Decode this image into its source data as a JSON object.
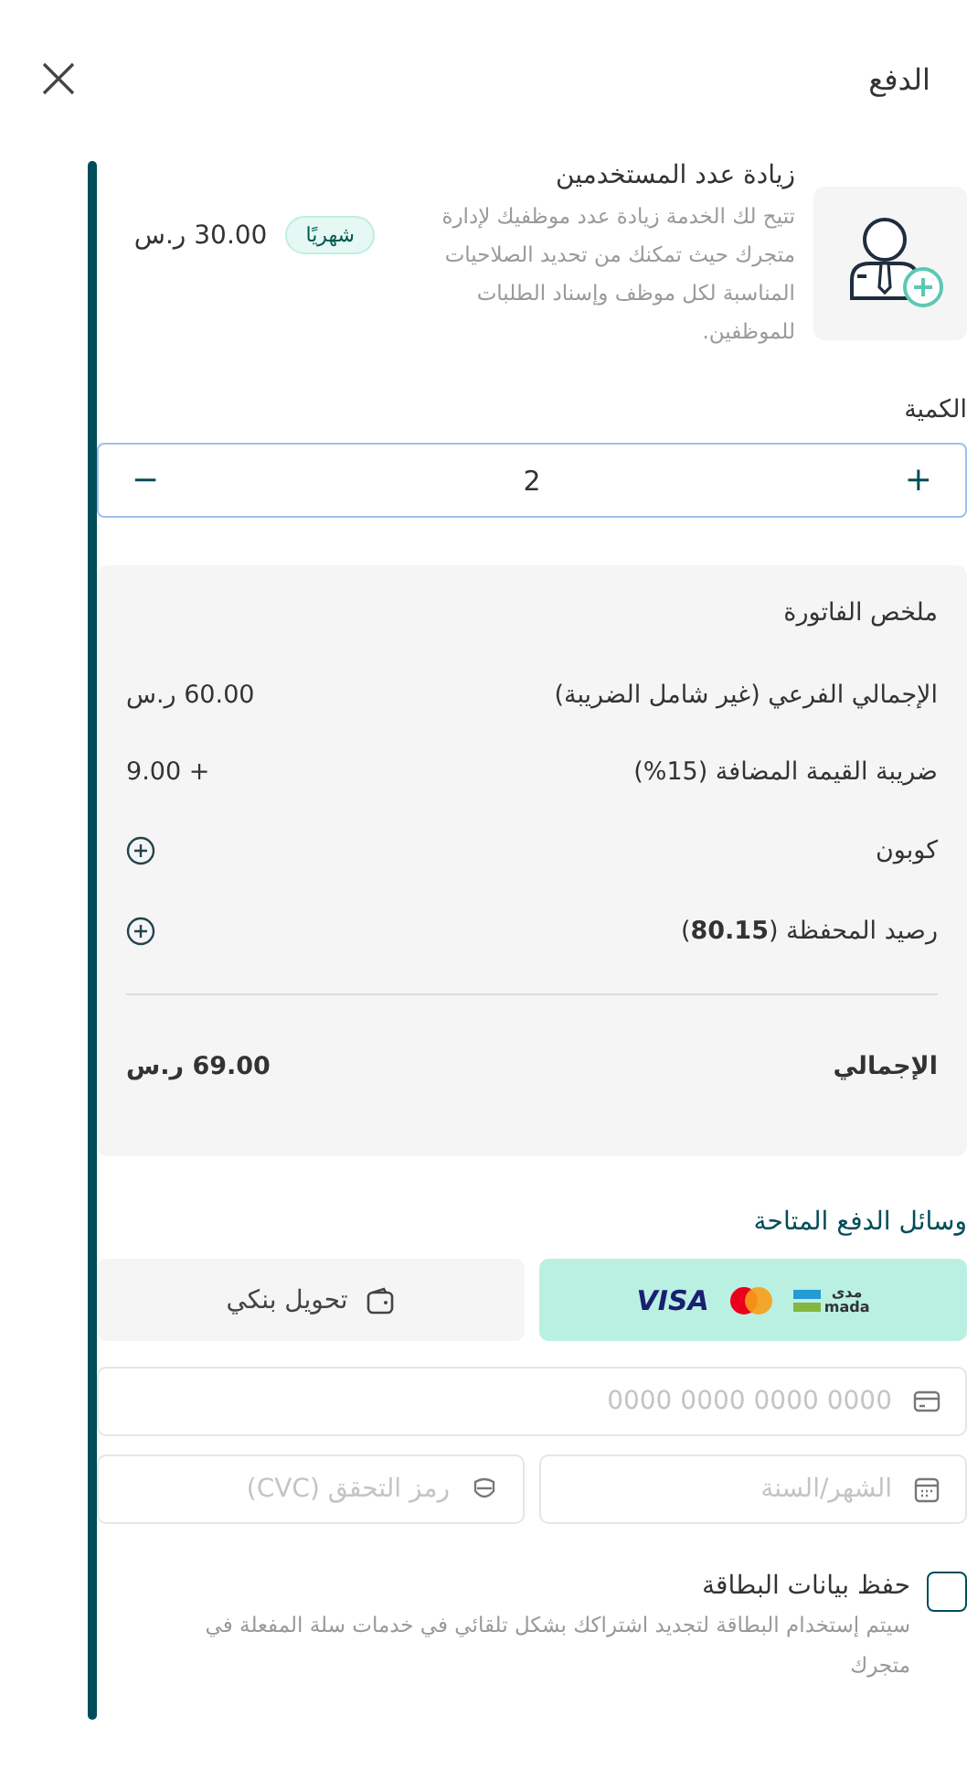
{
  "header": {
    "title": "الدفع"
  },
  "product": {
    "name": "زيادة عدد المستخدمين",
    "description": "تتيح لك الخدمة زيادة عدد موظفيك لإدارة متجرك حيث تمكنك من تحديد الصلاحيات المناسبة لكل موظف وإسناد الطلبات للموظفين.",
    "period": "شهريًا",
    "price": "30.00 ر.س"
  },
  "quantity": {
    "label": "الكمية",
    "value": "2",
    "plus": "+",
    "minus": "−"
  },
  "invoice": {
    "title": "ملخص الفاتورة",
    "rows": [
      {
        "kind": "value",
        "label": "الإجمالي الفرعي (غير شامل الضريبة)",
        "value": "60.00 ر.س"
      },
      {
        "kind": "value",
        "label": "ضريبة القيمة المضافة (15%)",
        "value": "+ 9.00"
      },
      {
        "kind": "add",
        "label": "كوبون"
      },
      {
        "kind": "add",
        "label": "رصيد المحفظة (**80.15**)"
      }
    ],
    "total": {
      "label": "الإجمالي",
      "value": "69.00 ر.س"
    }
  },
  "payment": {
    "title": "وسائل الدفع المتاحة",
    "methods": [
      {
        "kind": "cards",
        "selected": true,
        "visa": "VISA",
        "mada_ar": "مدى",
        "mada": "mada"
      },
      {
        "kind": "bank",
        "selected": false,
        "label": "تحويل بنكي"
      }
    ]
  },
  "card_form": {
    "number_placeholder": "0000 0000 0000 0000",
    "expiry_placeholder": "الشهر/السنة",
    "cvc_placeholder": "رمز التحقق (CVC)"
  },
  "save_card": {
    "label": "حفظ بيانات البطاقة",
    "checked": false,
    "note": "سيتم إستخدام البطاقة لتجديد اشتراكك بشكل تلقائي في خدمات سلة المفعلة في متجرك"
  }
}
